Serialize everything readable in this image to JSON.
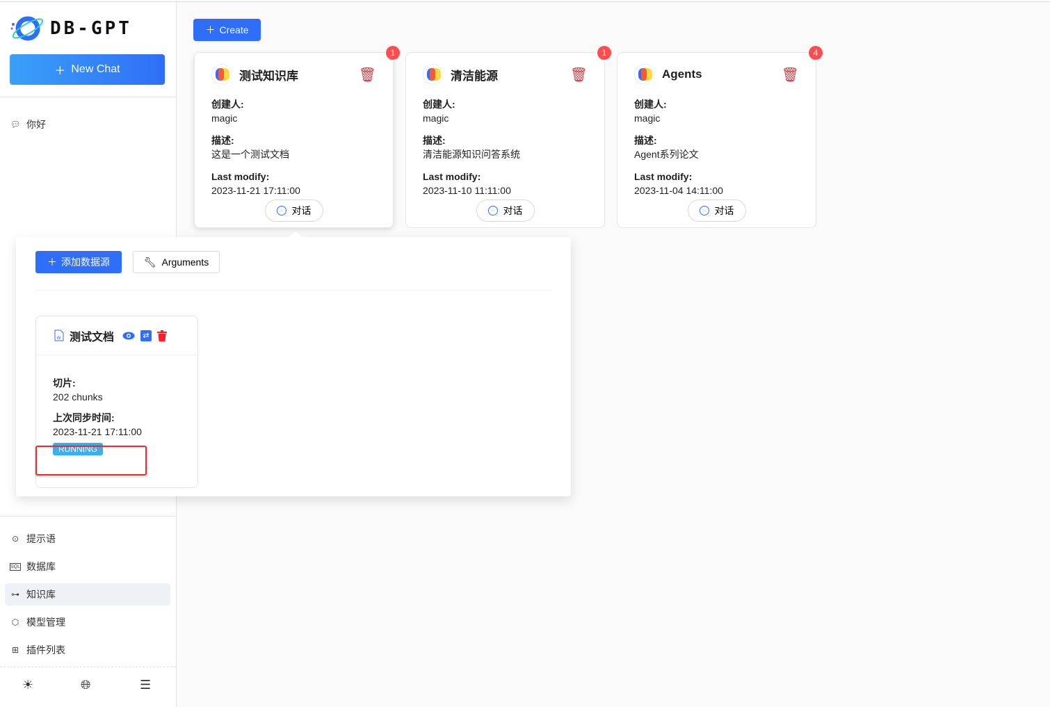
{
  "sidebar": {
    "logo_text": "DB-GPT",
    "new_chat": "New Chat",
    "history": [
      {
        "label": "你好",
        "icon": "chat-icon"
      }
    ],
    "nav": [
      {
        "label": "提示语",
        "icon": "chat-icon"
      },
      {
        "label": "数据库",
        "icon": "sql-icon"
      },
      {
        "label": "知识库",
        "icon": "knowledge-icon",
        "active": true
      },
      {
        "label": "模型管理",
        "icon": "cube-icon"
      },
      {
        "label": "插件列表",
        "icon": "plugin-icon"
      }
    ],
    "bottom": [
      "sun-icon",
      "globe-icon",
      "menu-fold-icon"
    ]
  },
  "main": {
    "create": "Create",
    "cards": [
      {
        "title": "测试知识库",
        "badge": "1",
        "creator_label": "创建人:",
        "creator": "magic",
        "desc_label": "描述:",
        "desc": "这是一个测试文档",
        "modify_label": "Last modify:",
        "modify": "2023-11-21 17:11:00",
        "chat": "对话"
      },
      {
        "title": "清洁能源",
        "badge": "1",
        "creator_label": "创建人:",
        "creator": "magic",
        "desc_label": "描述:",
        "desc": "清洁能源知识问答系统",
        "modify_label": "Last modify:",
        "modify": "2023-11-10 11:11:00",
        "chat": "对话"
      },
      {
        "title": "Agents",
        "badge": "4",
        "creator_label": "创建人:",
        "creator": "magic",
        "desc_label": "描述:",
        "desc": "Agent系列论文",
        "modify_label": "Last modify:",
        "modify": "2023-11-04 14:11:00",
        "chat": "对话"
      }
    ]
  },
  "popover": {
    "add_datasource": "添加数据源",
    "arguments": "Arguments",
    "doc": {
      "title": "测试文档",
      "chunks_label": "切片:",
      "chunks": "202 chunks",
      "sync_label": "上次同步时间:",
      "sync": "2023-11-21 17:11:00",
      "status": "RUNNING"
    }
  },
  "colors": {
    "primary": "#2f6ef8",
    "danger": "#ff4d4f",
    "running": "#3aaeee"
  }
}
